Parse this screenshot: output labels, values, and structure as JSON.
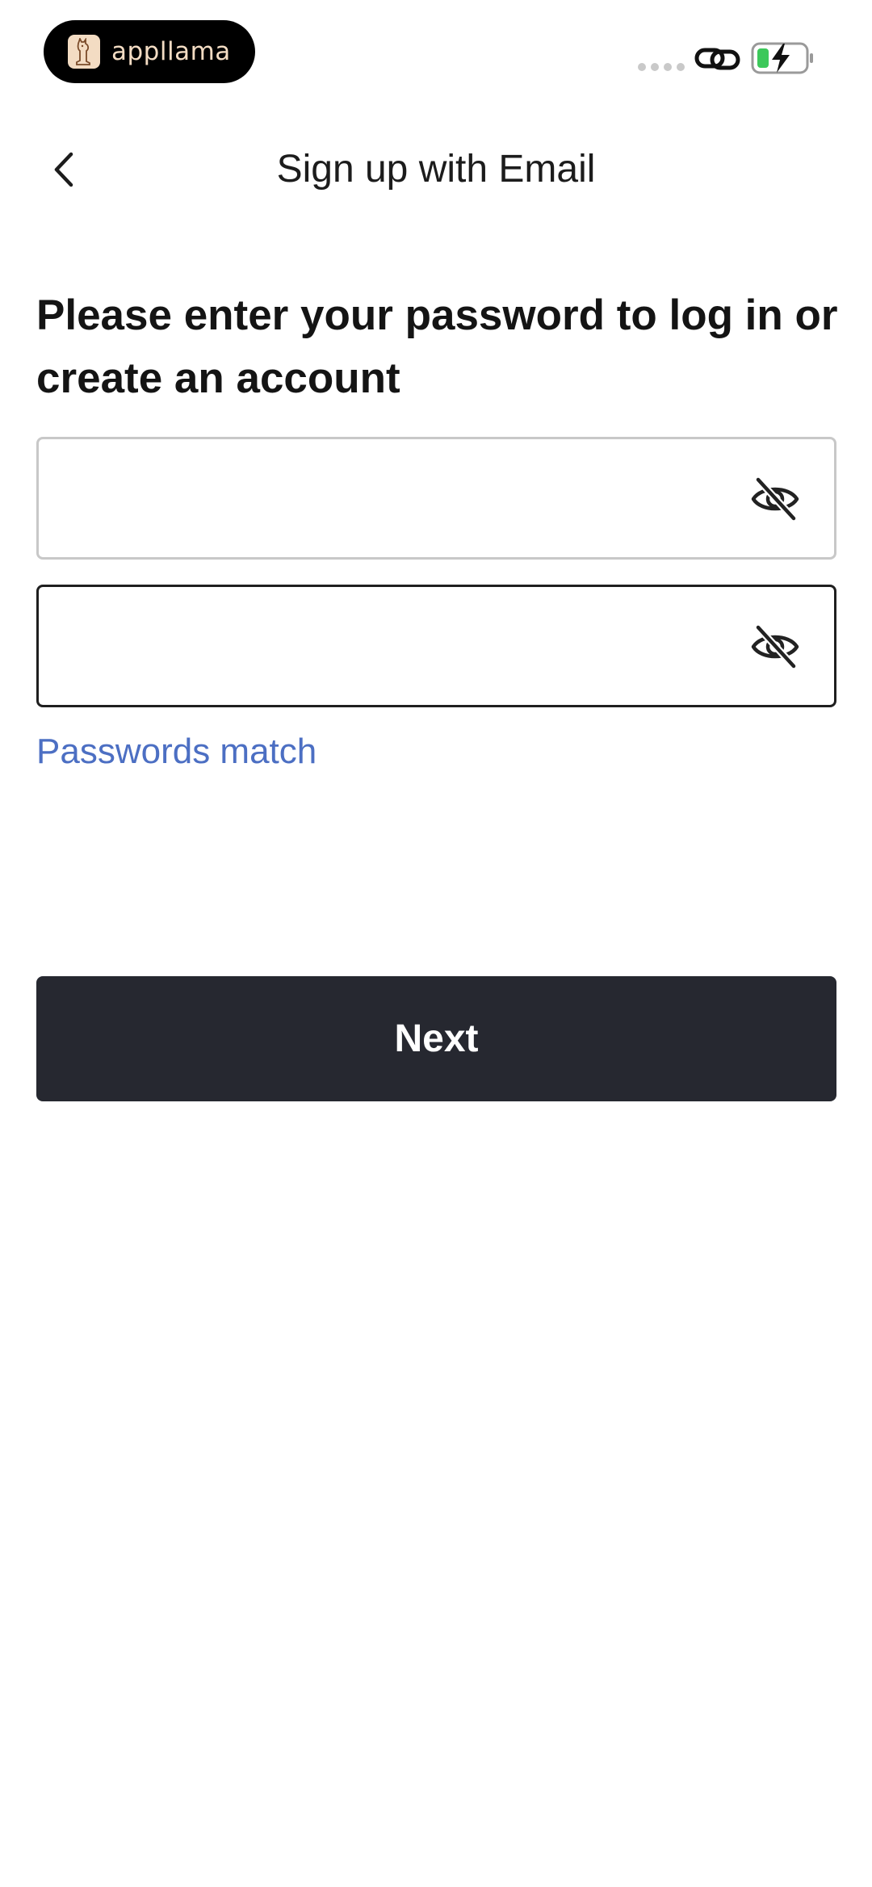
{
  "status_bar": {
    "brand_name": "appllama",
    "brand_color": "#f3dcc3",
    "icons": [
      "signal-dots-icon",
      "link-icon",
      "battery-charging-icon"
    ],
    "battery_fill_color": "#3cc85a"
  },
  "header": {
    "back_icon": "chevron-left-icon",
    "title": "Sign up with Email"
  },
  "main": {
    "instruction": "Please enter your password to log in or create an account",
    "password_field": {
      "value": "",
      "placeholder": "",
      "toggle_icon": "eye-off-icon"
    },
    "confirm_password_field": {
      "value": "",
      "placeholder": "",
      "toggle_icon": "eye-off-icon"
    },
    "match_message": "Passwords match",
    "match_color": "#4c6fc3",
    "next_label": "Next",
    "next_button_color": "#262830"
  }
}
